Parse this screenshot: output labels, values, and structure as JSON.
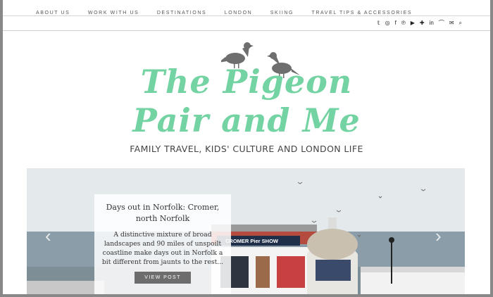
{
  "nav": {
    "items": [
      "ABOUT US",
      "WORK WITH US",
      "DESTINATIONS",
      "LONDON",
      "SKIING",
      "TRAVEL TIPS & ACCESSORIES"
    ]
  },
  "social": {
    "icons": [
      "twitter-icon",
      "instagram-icon",
      "facebook-icon",
      "pinterest-icon",
      "youtube-icon",
      "google-plus-icon",
      "linkedin-icon",
      "rss-icon",
      "email-icon",
      "search-icon"
    ],
    "glyphs": [
      "𝕥",
      "◎",
      "f",
      "℗",
      "▶",
      "✚",
      "in",
      "⌒",
      "✉",
      "⌕"
    ]
  },
  "header": {
    "logo_line1": "The Pigeon",
    "logo_line2": "Pair and Me",
    "tagline": "FAMILY TRAVEL, KIDS' CULTURE AND LONDON LIFE"
  },
  "slider": {
    "title": "Days out in Norfolk: Cromer, north Norfolk",
    "excerpt": "A distinctive mixture of broad landscapes and 90 miles of unspoilt coastline make days out in Norfolk a bit different from jaunts to the rest...",
    "button": "VIEW POST",
    "sign_text": "CROMER Pier SHOW",
    "prev_icon": "chevron-left-icon",
    "next_icon": "chevron-right-icon"
  },
  "colors": {
    "brand": "#73d3a2",
    "sea": "#8a9da8",
    "sky": "#e4e9ec",
    "button": "#6d6d6d"
  }
}
